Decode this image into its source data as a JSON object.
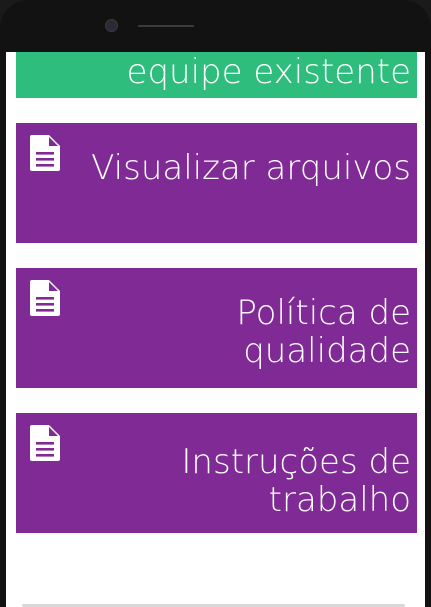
{
  "tiles": [
    {
      "label": "equipe existente",
      "color": "#2ebd7c"
    },
    {
      "label": "Visualizar arquivos",
      "color": "#802a95",
      "icon": "document-icon"
    },
    {
      "label": "Política de qualidade",
      "color": "#802a95",
      "icon": "document-icon"
    },
    {
      "label": "Instruções de trabalho",
      "color": "#802a95",
      "icon": "document-icon"
    }
  ]
}
